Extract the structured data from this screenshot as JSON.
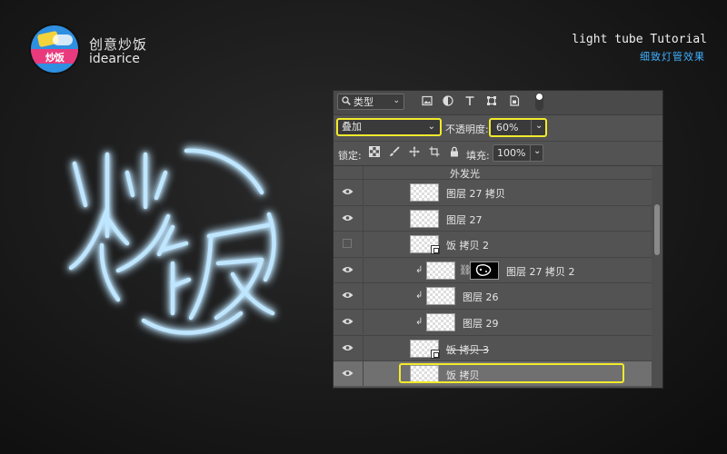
{
  "brand": {
    "logo_text": "炒饭",
    "name_cn": "创意炒饭",
    "name_en": "idearice"
  },
  "tutorial": {
    "title_en": "light tube Tutorial",
    "title_cn": "细致灯管效果"
  },
  "art": {
    "glyphs": "炒饭",
    "neon_color": "#3aa8ff"
  },
  "panel": {
    "filter": {
      "label": "类型",
      "icon": "search-icon"
    },
    "filter_icons": [
      "image-filter-icon",
      "adjustment-filter-icon",
      "type-filter-icon",
      "shape-filter-icon",
      "smart-object-filter-icon"
    ],
    "blend_mode": "叠加",
    "opacity_label": "不透明度:",
    "opacity_value": "60%",
    "lock_label": "锁定:",
    "lock_icons": [
      "lock-transparent-icon",
      "lock-paint-icon",
      "lock-move-icon",
      "lock-artboard-icon",
      "lock-all-icon"
    ],
    "fill_label": "填充:",
    "fill_value": "100%",
    "effect_label": "外发光",
    "highlight_color": "#f2ea2c",
    "layers": [
      {
        "name": "图层 27 拷贝",
        "visible": true,
        "clipped": false,
        "smart": false,
        "mask": false,
        "selected": false,
        "strike": false
      },
      {
        "name": "图层 27",
        "visible": true,
        "clipped": false,
        "smart": false,
        "mask": false,
        "selected": false,
        "strike": false
      },
      {
        "name": "饭 拷贝 2",
        "visible": false,
        "clipped": false,
        "smart": true,
        "mask": false,
        "selected": false,
        "strike": false
      },
      {
        "name": "图层 27 拷贝 2",
        "visible": true,
        "clipped": true,
        "smart": false,
        "mask": true,
        "selected": false,
        "strike": false
      },
      {
        "name": "图层 26",
        "visible": true,
        "clipped": true,
        "smart": false,
        "mask": false,
        "selected": false,
        "strike": false
      },
      {
        "name": "图层 29",
        "visible": true,
        "clipped": true,
        "smart": false,
        "mask": false,
        "selected": false,
        "strike": false
      },
      {
        "name": "饭 拷贝 3",
        "visible": true,
        "clipped": false,
        "smart": true,
        "mask": false,
        "selected": false,
        "strike": true
      },
      {
        "name": "饭 拷贝",
        "visible": true,
        "clipped": false,
        "smart": false,
        "mask": false,
        "selected": true,
        "strike": false
      }
    ]
  }
}
